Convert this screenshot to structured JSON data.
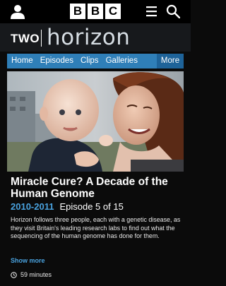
{
  "header": {
    "logo_letters": [
      "B",
      "B",
      "C"
    ]
  },
  "channel": {
    "name": "TWO",
    "brand": "horizon"
  },
  "nav": {
    "tabs": [
      "Home",
      "Episodes",
      "Clips",
      "Galleries"
    ],
    "more": "More"
  },
  "programme": {
    "title": "Miracle Cure? A Decade of the Human Genome",
    "series": "2010-2011",
    "episode": "Episode 5 of 15",
    "description": "Horizon follows three people, each with a genetic disease, as they visit Britain's leading research labs to find out what the sequencing of the human genome has done for them.",
    "show_more": "Show more",
    "duration": "59 minutes"
  },
  "colors": {
    "nav_blue": "#2f7fb8",
    "accent_blue": "#4aa3e0"
  },
  "icons": [
    "account-icon",
    "menu-icon",
    "search-icon",
    "clock-icon"
  ]
}
